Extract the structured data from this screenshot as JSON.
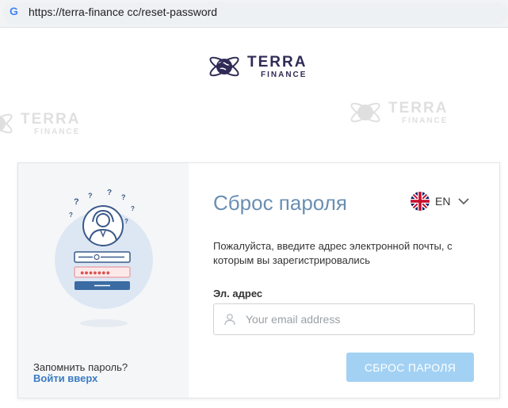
{
  "browser": {
    "url": "https://terra-finance cc/reset-password",
    "icon": "google-g-icon"
  },
  "brand": {
    "name_line1": "TERRA",
    "name_line2": "FINANCE",
    "color": "#302b56"
  },
  "left_panel": {
    "remember_text": "Запомнить пароль?",
    "login_link": "Войти вверх"
  },
  "form": {
    "title": "Сброс пароля",
    "language": "EN",
    "description": "Пожалуйста, введите адрес электронной почты, с которым вы зарегистрировались",
    "email_label": "Эл. адрес",
    "email_placeholder": "Your email address",
    "email_value": "",
    "submit_label": "СБРОС ПАРОЛЯ"
  },
  "colors": {
    "title": "#6a8fb2",
    "link": "#3a7cc3",
    "button": "#a3d1f3"
  }
}
